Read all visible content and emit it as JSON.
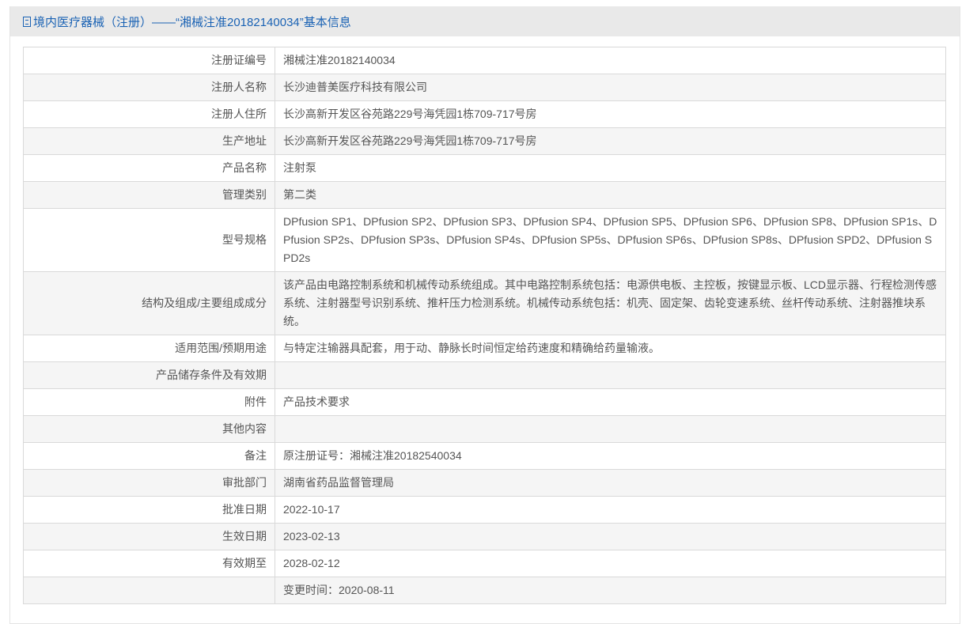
{
  "header": {
    "title": "境内医疗器械（注册）——“湘械注准20182140034”基本信息"
  },
  "rows": [
    {
      "label": "注册证编号",
      "value": "湘械注准20182140034"
    },
    {
      "label": "注册人名称",
      "value": "长沙迪普美医疗科技有限公司"
    },
    {
      "label": "注册人住所",
      "value": "长沙高新开发区谷苑路229号海凭园1栋709-717号房"
    },
    {
      "label": "生产地址",
      "value": "长沙高新开发区谷苑路229号海凭园1栋709-717号房"
    },
    {
      "label": "产品名称",
      "value": "注射泵"
    },
    {
      "label": "管理类别",
      "value": "第二类"
    },
    {
      "label": "型号规格",
      "value": "DPfusion SP1、DPfusion SP2、DPfusion SP3、DPfusion SP4、DPfusion SP5、DPfusion SP6、DPfusion SP8、DPfusion SP1s、DPfusion SP2s、DPfusion SP3s、DPfusion SP4s、DPfusion SP5s、DPfusion SP6s、DPfusion SP8s、DPfusion SPD2、DPfusion SPD2s"
    },
    {
      "label": "结构及组成/主要组成成分",
      "value": "该产品由电路控制系统和机械传动系统组成。其中电路控制系统包括：电源供电板、主控板，按键显示板、LCD显示器、行程检测传感系统、注射器型号识别系统、推杆压力检测系统。机械传动系统包括：机壳、固定架、齿轮变速系统、丝杆传动系统、注射器推块系统。"
    },
    {
      "label": "适用范围/预期用途",
      "value": "与特定注输器具配套，用于动、静脉长时间恒定给药速度和精确给药量输液。"
    },
    {
      "label": "产品储存条件及有效期",
      "value": ""
    },
    {
      "label": "附件",
      "value": "产品技术要求"
    },
    {
      "label": "其他内容",
      "value": ""
    },
    {
      "label": "备注",
      "value": "原注册证号：湘械注准20182540034"
    },
    {
      "label": "审批部门",
      "value": "湖南省药品监督管理局"
    },
    {
      "label": "批准日期",
      "value": "2022-10-17"
    },
    {
      "label": "生效日期",
      "value": "2023-02-13"
    },
    {
      "label": "有效期至",
      "value": "2028-02-12"
    },
    {
      "label": "",
      "value": "变更时间：2020-08-11"
    }
  ]
}
